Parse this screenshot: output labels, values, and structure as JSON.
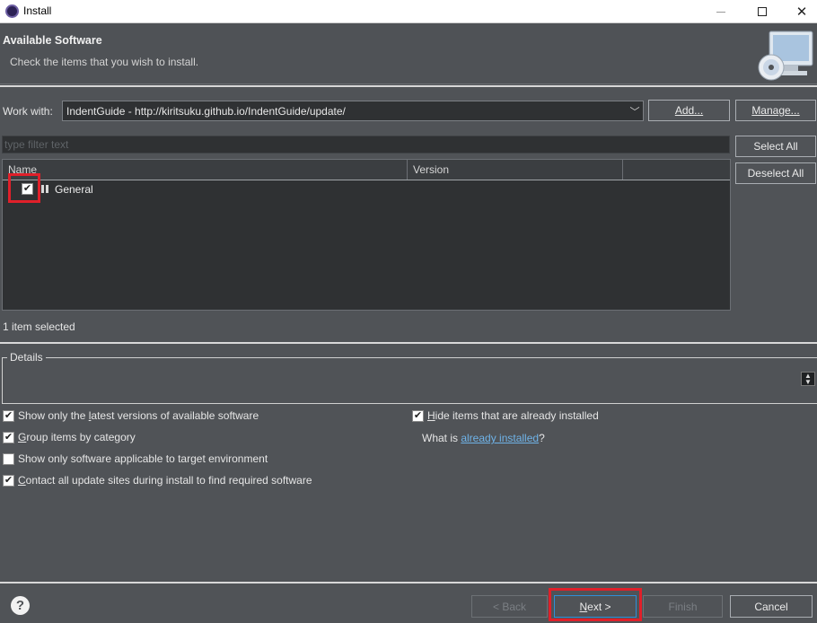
{
  "window": {
    "title": "Install"
  },
  "header": {
    "title": "Available Software",
    "subtitle": "Check the items that you wish to install."
  },
  "work_with": {
    "label": "Work with:",
    "value": "IndentGuide - http://kiritsuku.github.io/IndentGuide/update/",
    "add_button": "Add...",
    "manage_button": "Manage..."
  },
  "filter": {
    "placeholder": "type filter text",
    "value": ""
  },
  "table": {
    "columns": [
      "Name",
      "Version",
      ""
    ],
    "rows": [
      {
        "label": "General",
        "version": "",
        "checked": true
      }
    ]
  },
  "side_buttons": {
    "select_all": "Select All",
    "deselect_all": "Deselect All"
  },
  "selection_status": "1 item selected",
  "details": {
    "legend": "Details"
  },
  "options": {
    "latest_versions": {
      "label_pre": "Show only the ",
      "label_u": "l",
      "label_post": "atest versions of available software",
      "checked": true
    },
    "group_by_category": {
      "label_pre": "",
      "label_u": "G",
      "label_post": "roup items by category",
      "checked": true
    },
    "target_environment": {
      "label": "Show only software applicable to target environment",
      "checked": false
    },
    "contact_update_sites": {
      "label_pre": "",
      "label_u": "C",
      "label_post": "ontact all update sites during install to find required software",
      "checked": true
    },
    "hide_installed": {
      "label_pre": "",
      "label_u": "H",
      "label_post": "ide items that are already installed",
      "checked": true
    },
    "what_is_pre": "What is ",
    "what_is_link": "already installed",
    "what_is_post": "?"
  },
  "footer": {
    "back": "< Back",
    "next_pre": "",
    "next_u": "N",
    "next_post": "ext >",
    "finish": "Finish",
    "cancel": "Cancel"
  },
  "colors": {
    "background": "#505357",
    "field": "#2f3133",
    "link": "#6fb3e8",
    "highlight": "#e0202a"
  }
}
